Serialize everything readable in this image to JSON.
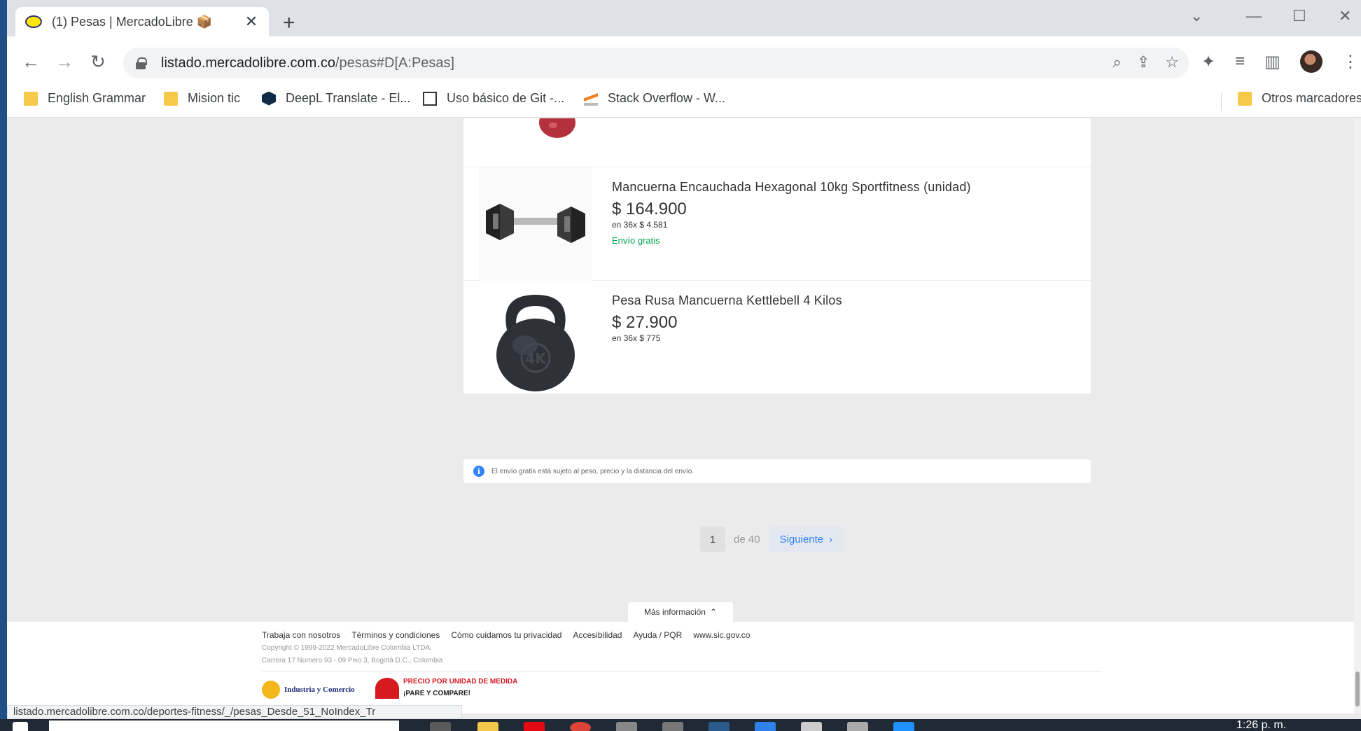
{
  "browser": {
    "tab_title": "(1) Pesas | MercadoLibre 📦",
    "new_tab": "+",
    "close_tab": "✕",
    "url_host": "listado.mercadolibre.com.co",
    "url_path": "/pesas#D[A:Pesas]",
    "status_url": "listado.mercadolibre.com.co/deportes-fitness/_/pesas_Desde_51_NoIndex_Tr"
  },
  "bookmarks": [
    {
      "label": "English Grammar",
      "icon": "folder-icon"
    },
    {
      "label": "Mision tic",
      "icon": "folder-icon"
    },
    {
      "label": "DeepL Translate - El...",
      "icon": "deepl-icon"
    },
    {
      "label": "Uso básico de Git -...",
      "icon": "git-icon"
    },
    {
      "label": "Stack Overflow - W...",
      "icon": "stackoverflow-icon"
    },
    {
      "label": "Otros marcadores",
      "icon": "folder-icon"
    }
  ],
  "products": [
    {
      "title": "Mancuerna Encauchada Hexagonal 10kg Sportfitness (unidad)",
      "price": "$ 164.900",
      "installments": "en 36x $ 4.581",
      "shipping": "Envío gratis",
      "image": "dumbbell-image"
    },
    {
      "title": "Pesa Rusa Mancuerna Kettlebell 4 Kilos",
      "price": "$ 27.900",
      "installments": "en 36x $ 775",
      "shipping": "",
      "image": "kettlebell-image",
      "kettlebell_mark": "4K"
    }
  ],
  "notice": {
    "text": "El envío gratis está sujeto al peso, precio y la distancia del envío."
  },
  "pagination": {
    "current": "1",
    "of": "de 40",
    "next": "Siguiente"
  },
  "footer": {
    "more_info": "Más información",
    "links": [
      "Trabaja con nosotros",
      "Términos y condiciones",
      "Cómo cuidamos tu privacidad",
      "Accesibilidad",
      "Ayuda / PQR",
      "www.sic.gov.co"
    ],
    "copyright": "Copyright © 1999-2022 MercadoLibre Colombia LTDA.",
    "address": "Carrera 17 Numero 93 - 09 Piso 3, Bogotá D.C., Colombia",
    "sic_label": "Industria y Comercio",
    "upm_title": "PRECIO POR UNIDAD DE MEDIDA",
    "upm_sub": "¡PARE Y COMPARE!"
  },
  "taskbar": {
    "clock": "1:26 p. m."
  },
  "colors": {
    "price_text": "#333333",
    "free_shipping": "#00a650",
    "link_blue": "#3483fa",
    "page_bg": "#ebebeb"
  }
}
